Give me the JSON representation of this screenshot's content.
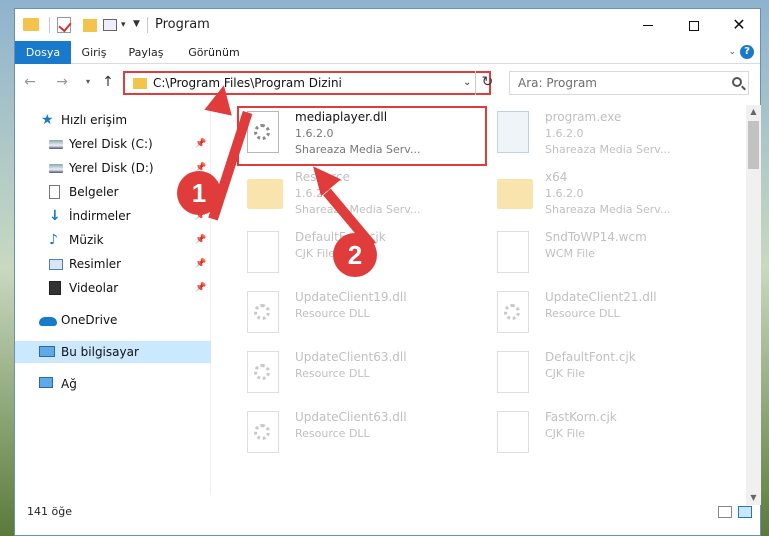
{
  "window": {
    "title": "Program",
    "quick_access": {
      "dropdown_glyph": "▾",
      "customize_glyph": "▼"
    },
    "controls": {
      "close_glyph": "✕"
    }
  },
  "ribbon": {
    "tabs": [
      {
        "label": "Dosya"
      },
      {
        "label": "Giriş"
      },
      {
        "label": "Paylaş"
      },
      {
        "label": "Görünüm"
      }
    ],
    "expand_glyph": "⌄",
    "help_glyph": "?"
  },
  "nav": {
    "back_glyph": "←",
    "forward_glyph": "→",
    "recent_glyph": "▾",
    "up_glyph": "↑",
    "address": "C:\\Program Files\\Program Dizini",
    "address_dropdown_glyph": "⌄",
    "refresh_glyph": "↻",
    "search_placeholder": "Ara: Program"
  },
  "sidebar": {
    "star_glyph": "★",
    "download_glyph": "↓",
    "music_glyph": "♪",
    "pin_glyph": "📌",
    "items": [
      {
        "label": "Hızlı erişim",
        "icon": "star-icon"
      },
      {
        "label": "Yerel Disk (C:)",
        "icon": "disk-icon",
        "pinned": true
      },
      {
        "label": "Yerel Disk (D:)",
        "icon": "disk-icon",
        "pinned": true
      },
      {
        "label": "Belgeler",
        "icon": "documents-icon",
        "pinned": true
      },
      {
        "label": "İndirmeler",
        "icon": "downloads-icon",
        "pinned": true
      },
      {
        "label": "Müzik",
        "icon": "music-icon",
        "pinned": true
      },
      {
        "label": "Resimler",
        "icon": "pictures-icon",
        "pinned": true
      },
      {
        "label": "Videolar",
        "icon": "videos-icon",
        "pinned": true
      },
      {
        "label": "OneDrive",
        "icon": "cloud-icon"
      },
      {
        "label": "Bu bilgisayar",
        "icon": "computer-icon",
        "selected": true
      },
      {
        "label": "Ağ",
        "icon": "network-icon"
      }
    ]
  },
  "files": [
    {
      "name": "mediaplayer.dll",
      "line2": "1.6.2.0",
      "line3": "Shareaza Media Serv...",
      "type": "dll",
      "highlighted": true
    },
    {
      "name": "program.exe",
      "line2": "1.6.2.0",
      "line3": "Shareaza Media Serv...",
      "type": "exe"
    },
    {
      "name": "Resource",
      "line2": "1.6.2.0",
      "line3": "Shareaza Media Serv...",
      "type": "folder"
    },
    {
      "name": "x64",
      "line2": "1.6.2.0",
      "line3": "Shareaza Media Serv...",
      "type": "folder"
    },
    {
      "name": "DefaultFont.cjk",
      "line2": "CJK File",
      "line3": "",
      "type": "file"
    },
    {
      "name": "SndToWP14.wcm",
      "line2": "WCM File",
      "line3": "",
      "type": "file"
    },
    {
      "name": "UpdateClient19.dll",
      "line2": "Resource DLL",
      "line3": "",
      "type": "dll"
    },
    {
      "name": "UpdateClient21.dll",
      "line2": "Resource DLL",
      "line3": "",
      "type": "dll"
    },
    {
      "name": "UpdateClient63.dll",
      "line2": "Resource DLL",
      "line3": "",
      "type": "dll"
    },
    {
      "name": "DefaultFont.cjk",
      "line2": "CJK File",
      "line3": "",
      "type": "file"
    },
    {
      "name": "UpdateClient63.dll",
      "line2": "Resource DLL",
      "line3": "",
      "type": "dll"
    },
    {
      "name": "FastKorn.cjk",
      "line2": "CJK File",
      "line3": "",
      "type": "file"
    }
  ],
  "scrollbar": {
    "up_glyph": "▲",
    "down_glyph": "▼"
  },
  "status": {
    "item_count": "141 öğe"
  },
  "annotations": {
    "step1": "1",
    "step2": "2"
  },
  "colors": {
    "accent": "#1979ca",
    "annotation": "#e03c3c",
    "selection": "#cce8ff"
  }
}
